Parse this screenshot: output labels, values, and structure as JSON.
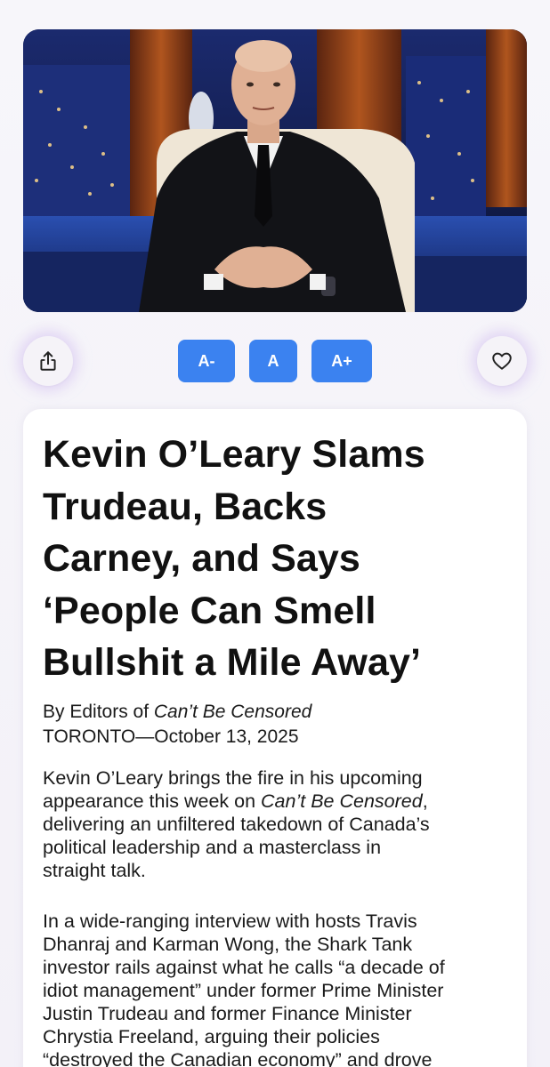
{
  "hero": {
    "image_label": "Photo of Kevin O'Leary seated in a chair on a studio set"
  },
  "toolbar": {
    "share_icon": "share-icon",
    "favorite_icon": "heart-icon",
    "font_decrease_label": "A-",
    "font_reset_label": "A",
    "font_increase_label": "A+",
    "accent_color": "#3b82f0"
  },
  "article": {
    "title_lines": [
      "Kevin O’Leary Slams",
      "Trudeau, Backs",
      "Carney, and Says",
      "‘People Can Smell",
      "Bullshit a Mile Away’"
    ],
    "byline_prefix": "By Editors of ",
    "byline_outlet": "Can’t Be Censored",
    "dateline": "TORONTO—October 13, 2025",
    "paragraph1": {
      "line1": "Kevin O’Leary brings the fire in his upcoming",
      "line2_pre": "appearance this week on ",
      "line2_em": "Can’t Be Censored",
      "line2_post": ",",
      "line3": "delivering an unfiltered takedown of Canada’s",
      "line4": "political leadership and a masterclass in",
      "line5": "straight talk."
    },
    "paragraph2_lines": [
      "In a wide-ranging interview with hosts Travis",
      "Dhanraj and Karman Wong, the Shark Tank",
      "investor rails against what he calls “a decade of",
      "idiot management” under former Prime Minister",
      "Justin Trudeau and former Finance Minister",
      "Chrystia Freeland, arguing their policies",
      "“destroyed the Canadian economy” and drove"
    ]
  }
}
